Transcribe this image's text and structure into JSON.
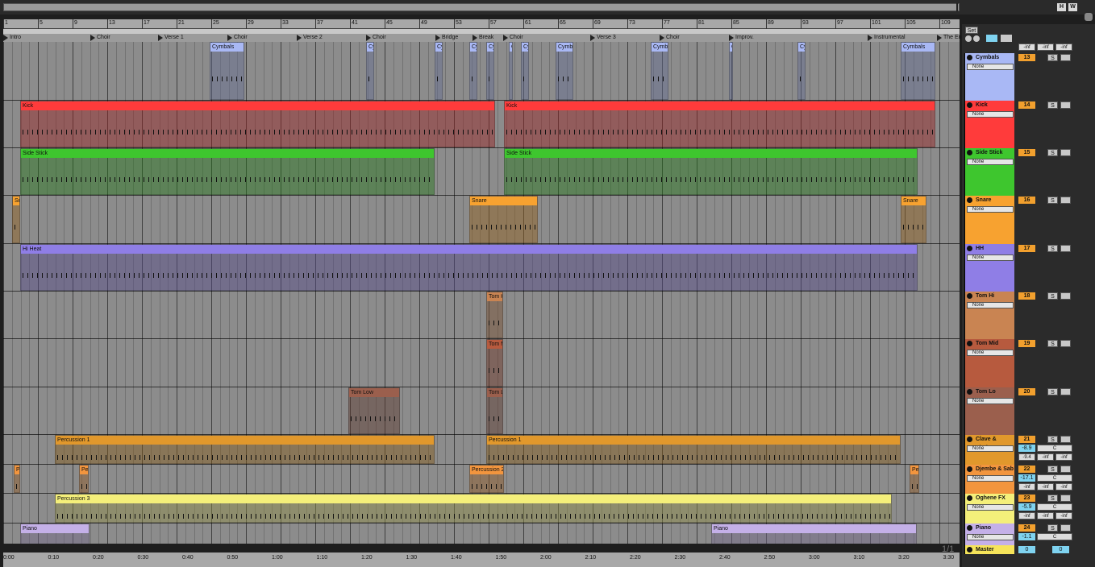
{
  "ruler": {
    "bars": [
      "1",
      "5",
      "9",
      "13",
      "17",
      "21",
      "25",
      "29",
      "33",
      "37",
      "41",
      "45",
      "49",
      "53",
      "57",
      "61",
      "65",
      "69",
      "73",
      "77",
      "81",
      "85",
      "89",
      "93",
      "97",
      "101",
      "105",
      "109"
    ]
  },
  "overview": {
    "hide_label": "H",
    "wrap_label": "W"
  },
  "locators": [
    "Intro",
    "Choir",
    "Verse 1",
    "Choir",
    "Verse 2",
    "Choir",
    "Bridge",
    "Break",
    "Choir",
    "Verse 3",
    "Choir",
    "Improv.",
    "Instrumental",
    "The End"
  ],
  "set_button": "Set",
  "timeline": [
    "0:00",
    "0:10",
    "0:20",
    "0:30",
    "0:40",
    "0:50",
    "1:00",
    "1:10",
    "1:20",
    "1:30",
    "1:40",
    "1:50",
    "2:00",
    "2:10",
    "2:20",
    "2:30",
    "2:40",
    "2:50",
    "3:00",
    "3:10",
    "3:20",
    "3:30"
  ],
  "fraction": "1/1",
  "master_levels": [
    "-inf",
    "-inf",
    "-inf"
  ],
  "tracks": [
    {
      "name": "Cymbals",
      "color": "#a9b8f5",
      "input": "None",
      "number": "13",
      "solo": "S",
      "clips": [
        {
          "label": "Cymbals"
        },
        {
          "label": "Cy"
        },
        {
          "label": "Cy"
        },
        {
          "label": "Cy"
        },
        {
          "label": "Cy"
        },
        {
          "label": "C"
        },
        {
          "label": "Cy"
        },
        {
          "label": "Cymb"
        },
        {
          "label": "Cymb"
        },
        {
          "label": "C"
        },
        {
          "label": "Cy"
        },
        {
          "label": "Cymbals"
        }
      ]
    },
    {
      "name": "Kick",
      "color": "#ff3b3b",
      "input": "None",
      "number": "14",
      "solo": "S",
      "clips": [
        {
          "label": "Kick"
        },
        {
          "label": "Kick"
        }
      ]
    },
    {
      "name": "Side Stick",
      "color": "#3ec62e",
      "input": "None",
      "number": "15",
      "solo": "S",
      "clips": [
        {
          "label": "Side Stick"
        },
        {
          "label": "Side Stick"
        }
      ]
    },
    {
      "name": "Snare",
      "color": "#f7a230",
      "input": "None",
      "number": "16",
      "solo": "S",
      "clips": [
        {
          "label": "Sn"
        },
        {
          "label": "Snare"
        },
        {
          "label": "Snare"
        }
      ]
    },
    {
      "name": "HH",
      "color": "#8f7ee6",
      "input": "None",
      "number": "17",
      "solo": "S",
      "clips": [
        {
          "label": "Hi Heat"
        }
      ]
    },
    {
      "name": "Tom Hi",
      "color": "#c98452",
      "input": "None",
      "number": "18",
      "solo": "S",
      "clips": [
        {
          "label": "Tom H"
        }
      ]
    },
    {
      "name": "Tom Mid",
      "color": "#b75a3e",
      "input": "None",
      "number": "19",
      "solo": "S",
      "clips": [
        {
          "label": "Tom M"
        }
      ]
    },
    {
      "name": "Tom Lo",
      "color": "#9b5f4d",
      "input": "None",
      "number": "20",
      "solo": "S",
      "clips": [
        {
          "label": "Tom Low"
        },
        {
          "label": "Tom Lo"
        }
      ]
    },
    {
      "name": "Clave & Shaker",
      "color": "#e1982c",
      "input": "None",
      "number": "21",
      "solo": "S",
      "vol": "-8.9",
      "pan": "C",
      "sends": [
        "-9.4",
        "-inf",
        "-inf"
      ],
      "clips": [
        {
          "label": "Percussion 1"
        },
        {
          "label": "Percussion 1"
        }
      ]
    },
    {
      "name": "Djembe & Sab",
      "color": "#f2953e",
      "input": "None",
      "number": "22",
      "solo": "S",
      "vol": "-17.1",
      "pan": "C",
      "sends": [
        "-inf",
        "-inf",
        "-inf"
      ],
      "clips": [
        {
          "label": "Pe"
        },
        {
          "label": "Per"
        },
        {
          "label": "Percussion 2"
        },
        {
          "label": "Pe"
        }
      ]
    },
    {
      "name": "Oghene FX",
      "color": "#f4ef7a",
      "input": "None",
      "number": "23",
      "solo": "S",
      "vol": "-5.9",
      "pan": "C",
      "sends": [
        "-inf",
        "-inf",
        "-inf"
      ],
      "clips": [
        {
          "label": "Percussion 3"
        }
      ]
    },
    {
      "name": "Piano",
      "color": "#c4b0e8",
      "input": "None",
      "number": "24",
      "solo": "S",
      "vol": "-1.1",
      "pan": "C",
      "clips": [
        {
          "label": "Piano"
        },
        {
          "label": "Piano"
        }
      ]
    }
  ],
  "master": {
    "name": "Master",
    "color": "#f6e45a",
    "vol": "0",
    "pan": "0"
  }
}
